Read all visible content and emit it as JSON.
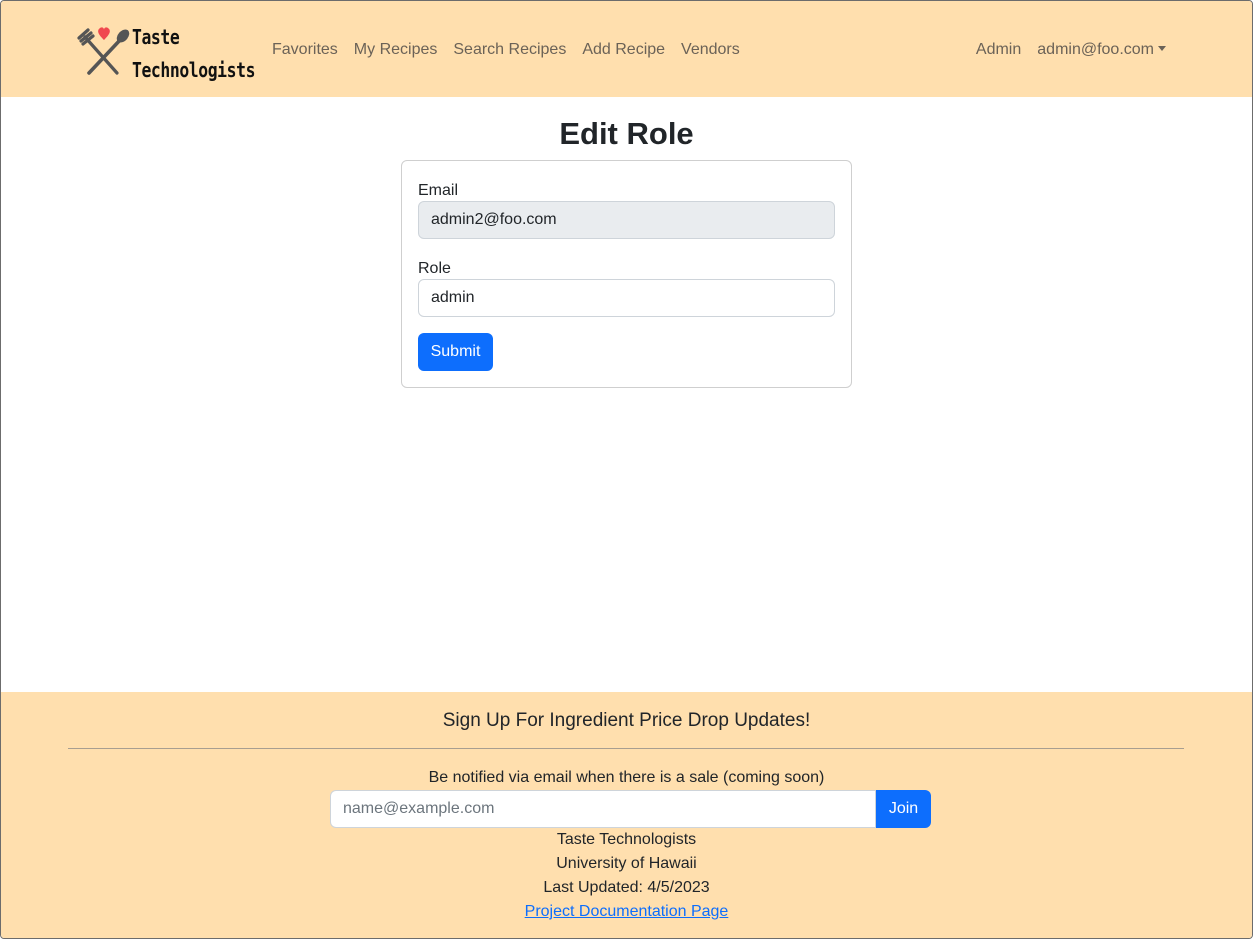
{
  "navbar": {
    "brand_line1": "Taste",
    "brand_line2": "Technologists",
    "links": [
      "Favorites",
      "My Recipes",
      "Search Recipes",
      "Add Recipe",
      "Vendors"
    ],
    "admin_label": "Admin",
    "user_menu_label": "admin@foo.com",
    "brand_icons": [
      "heart-icon",
      "fork-icon",
      "spoon-icon"
    ],
    "background_color": "#ffdfae"
  },
  "main": {
    "title": "Edit Role",
    "form": {
      "email_label": "Email",
      "email_value": "admin2@foo.com",
      "role_label": "Role",
      "role_value": "admin",
      "submit_label": "Submit"
    }
  },
  "footer": {
    "heading": "Sign Up For Ingredient Price Drop Updates!",
    "subtext": "Be notified via email when there is a sale (coming soon)",
    "email_placeholder": "name@example.com",
    "join_label": "Join",
    "org_name": "Taste Technologists",
    "university": "University of Hawaii",
    "last_updated": "Last Updated: 4/5/2023",
    "doc_link_label": "Project Documentation Page"
  },
  "colors": {
    "accent": "#0d6efd",
    "heart": "#f0484f"
  }
}
